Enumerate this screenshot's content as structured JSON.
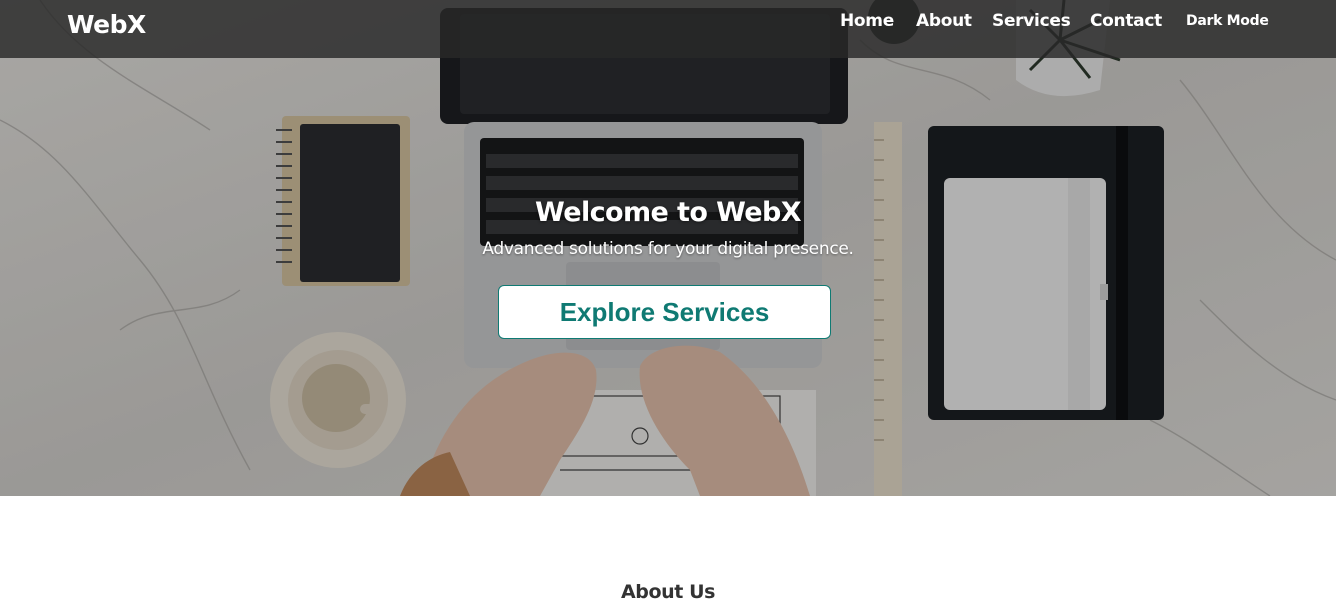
{
  "navbar": {
    "brand": "WebX",
    "links": [
      "Home",
      "About",
      "Services",
      "Contact"
    ],
    "dark_mode_label": "Dark Mode"
  },
  "hero": {
    "title": "Welcome to WebX",
    "subtitle": "Advanced solutions for your digital presence.",
    "cta_label": "Explore Services",
    "image_description_icon": "desk-workspace-photo",
    "colors": {
      "accent": "#0f7a73",
      "navbar_bg": "#2a2a2a"
    }
  },
  "about": {
    "heading": "About Us"
  }
}
